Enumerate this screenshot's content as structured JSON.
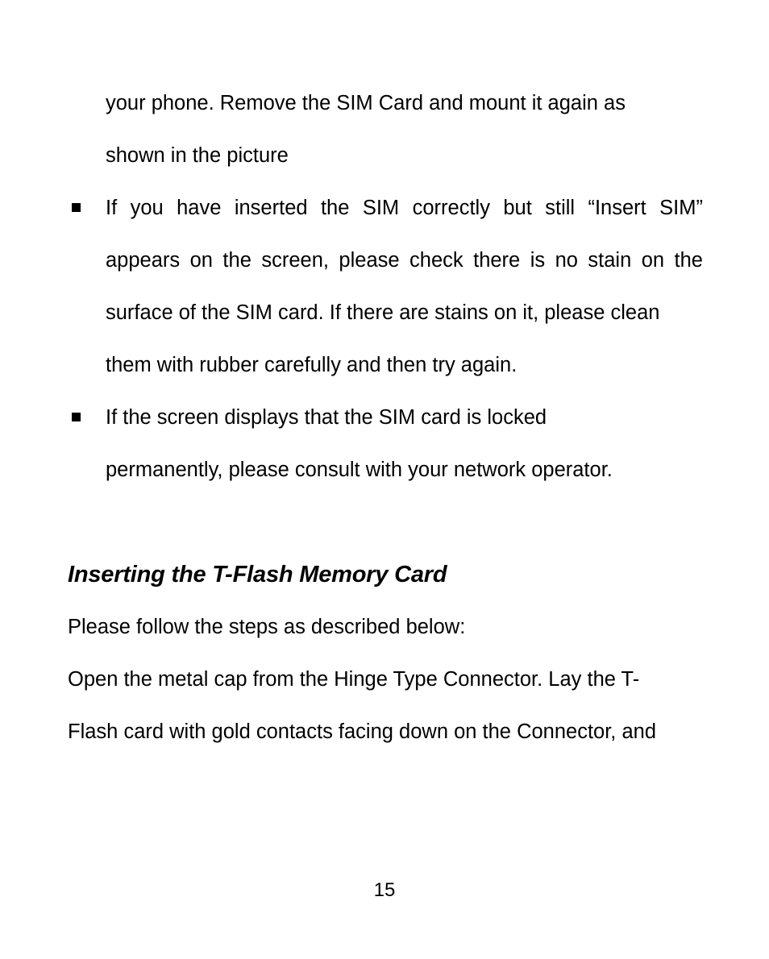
{
  "document": {
    "page_number": "15",
    "text_color": "#000000",
    "background_color": "#ffffff"
  },
  "continued_paragraph": {
    "line1": "your phone. Remove the SIM Card and mount it again as",
    "line2": "shown in the picture"
  },
  "bullets": [
    {
      "marker": "square-bullet",
      "line1": "If you have inserted the SIM correctly but still “Insert SIM”",
      "line2": "appears on the screen, please check there is no stain on the",
      "line3": "surface of the SIM card. If there are stains on it, please clean",
      "line4": "them with rubber carefully and then try again."
    },
    {
      "marker": "square-bullet",
      "line1": "If the screen displays that the SIM card is locked",
      "line2": "permanently, please consult with your network operator."
    }
  ],
  "section": {
    "heading": "Inserting the T-Flash Memory Card",
    "intro": "Please follow the steps as described below:",
    "step_line1": "Open the metal cap from the Hinge Type Connector. Lay the T-",
    "step_line2": "Flash card with gold contacts facing down on the Connector, and"
  }
}
